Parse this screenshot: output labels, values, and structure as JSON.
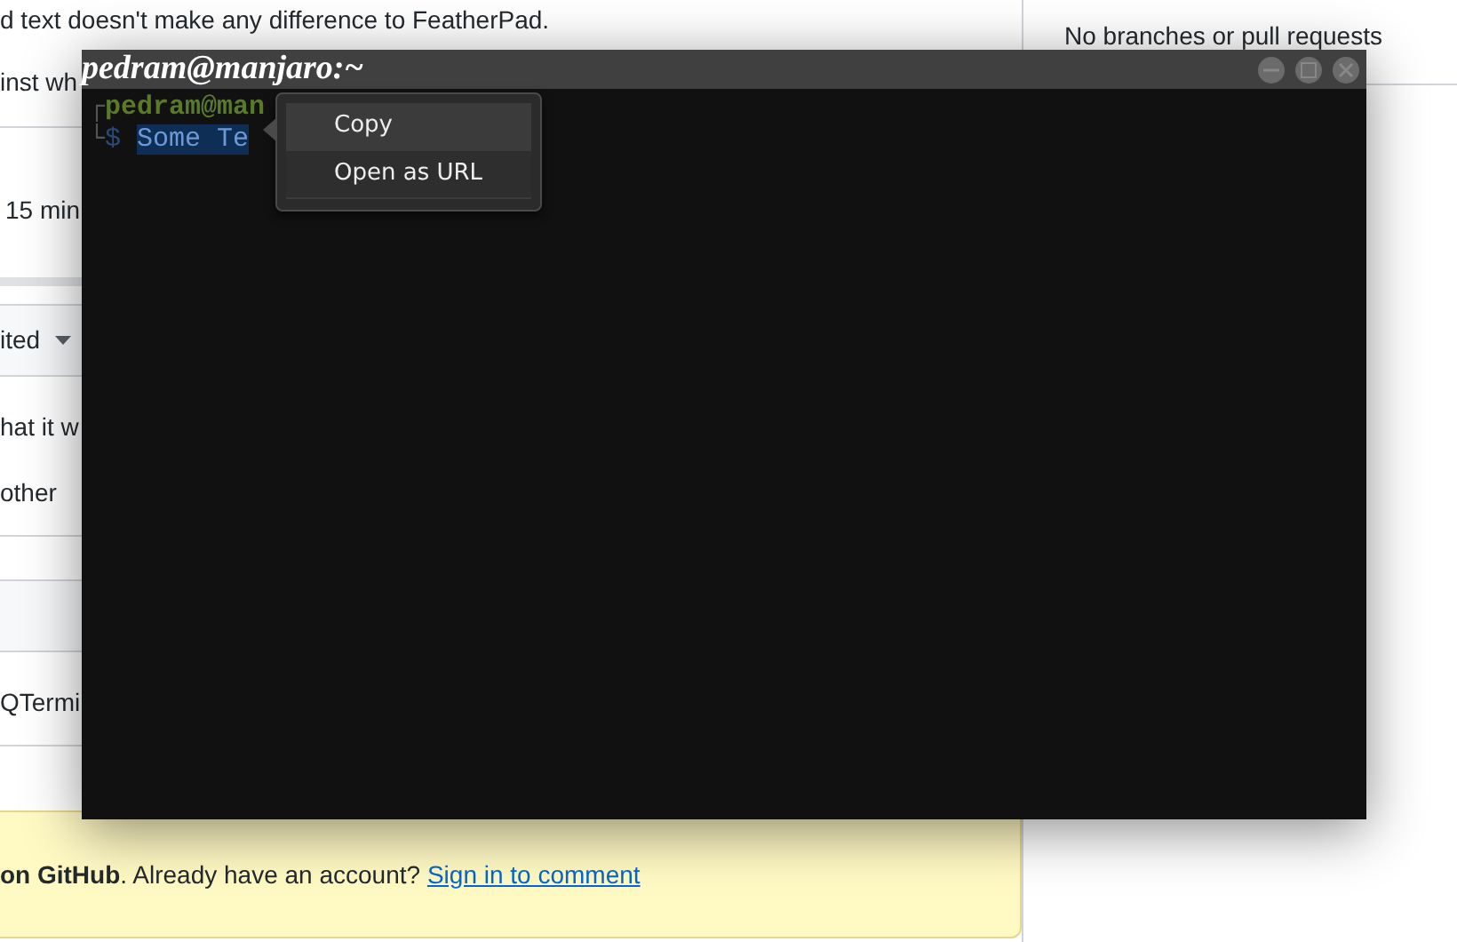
{
  "page": {
    "lines": [
      {
        "kind": "text",
        "text": "d text doesn't make any difference to FeatherPad."
      },
      {
        "kind": "text",
        "text": "inst wh"
      },
      {
        "kind": "rule"
      },
      {
        "kind": "time",
        "text": "15 min"
      }
    ],
    "comments": [
      {
        "header": "ited",
        "dropdown": true,
        "body": [
          "hat it w",
          "other"
        ]
      },
      {
        "dropdown": false,
        "body": [
          "QTermi"
        ]
      }
    ],
    "signin": {
      "text": "**on GitHub**. Already have an account? ",
      "link": "Sign in to comment"
    },
    "sidebar": {
      "development": "No branches or pull requests"
    }
  },
  "terminal": {
    "title": "pedram@manjaro:~",
    "buttons": [
      {
        "kind": "minimize"
      },
      {
        "kind": "maximize"
      },
      {
        "kind": "close"
      }
    ],
    "prompt": {
      "corner_top": "┌",
      "user": "pedram@man",
      "corner_bottom": "└",
      "symbol": "$",
      "command": "Some Te",
      "command_selected": true
    },
    "context_menu": [
      {
        "label": "Copy",
        "selected": true
      },
      {
        "label": "Open as URL",
        "selected": false
      }
    ]
  }
}
